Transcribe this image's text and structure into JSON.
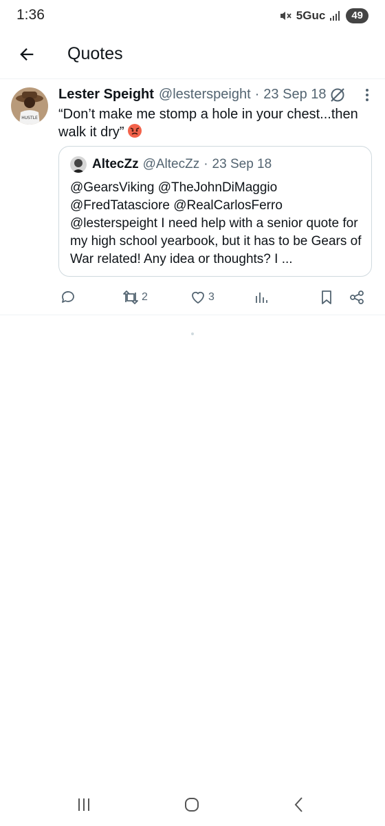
{
  "status_bar": {
    "time": "1:36",
    "network": "5Guc",
    "battery": "49",
    "icons": [
      "mute-icon",
      "signal-icon"
    ]
  },
  "header": {
    "title": "Quotes",
    "back_icon": "arrow-left-icon"
  },
  "tweet": {
    "author_name": "Lester Speight",
    "author_handle": "@lesterspeight",
    "separator": "·",
    "date": "23 Sep 18",
    "text": "“Don’t make me stomp a hole in your chest...then walk it dry”",
    "emoji": "angry-face-emoji",
    "quoted": {
      "author_name": "AltecZz",
      "author_handle": "@AltecZz",
      "separator": "·",
      "date": "23 Sep 18",
      "text": "@GearsViking @TheJohnDiMaggio @FredTatasciore @RealCarlosFerro @lesterspeight I need help with a senior quote for my high school yearbook, but it has to be Gears of War related! Any idea or thoughts? I ..."
    },
    "actions": {
      "reply_count": "",
      "retweet_count": "2",
      "like_count": "3",
      "views_count": ""
    }
  },
  "colors": {
    "text_primary": "#0f1419",
    "text_secondary": "#536471",
    "border": "#eff3f4"
  }
}
